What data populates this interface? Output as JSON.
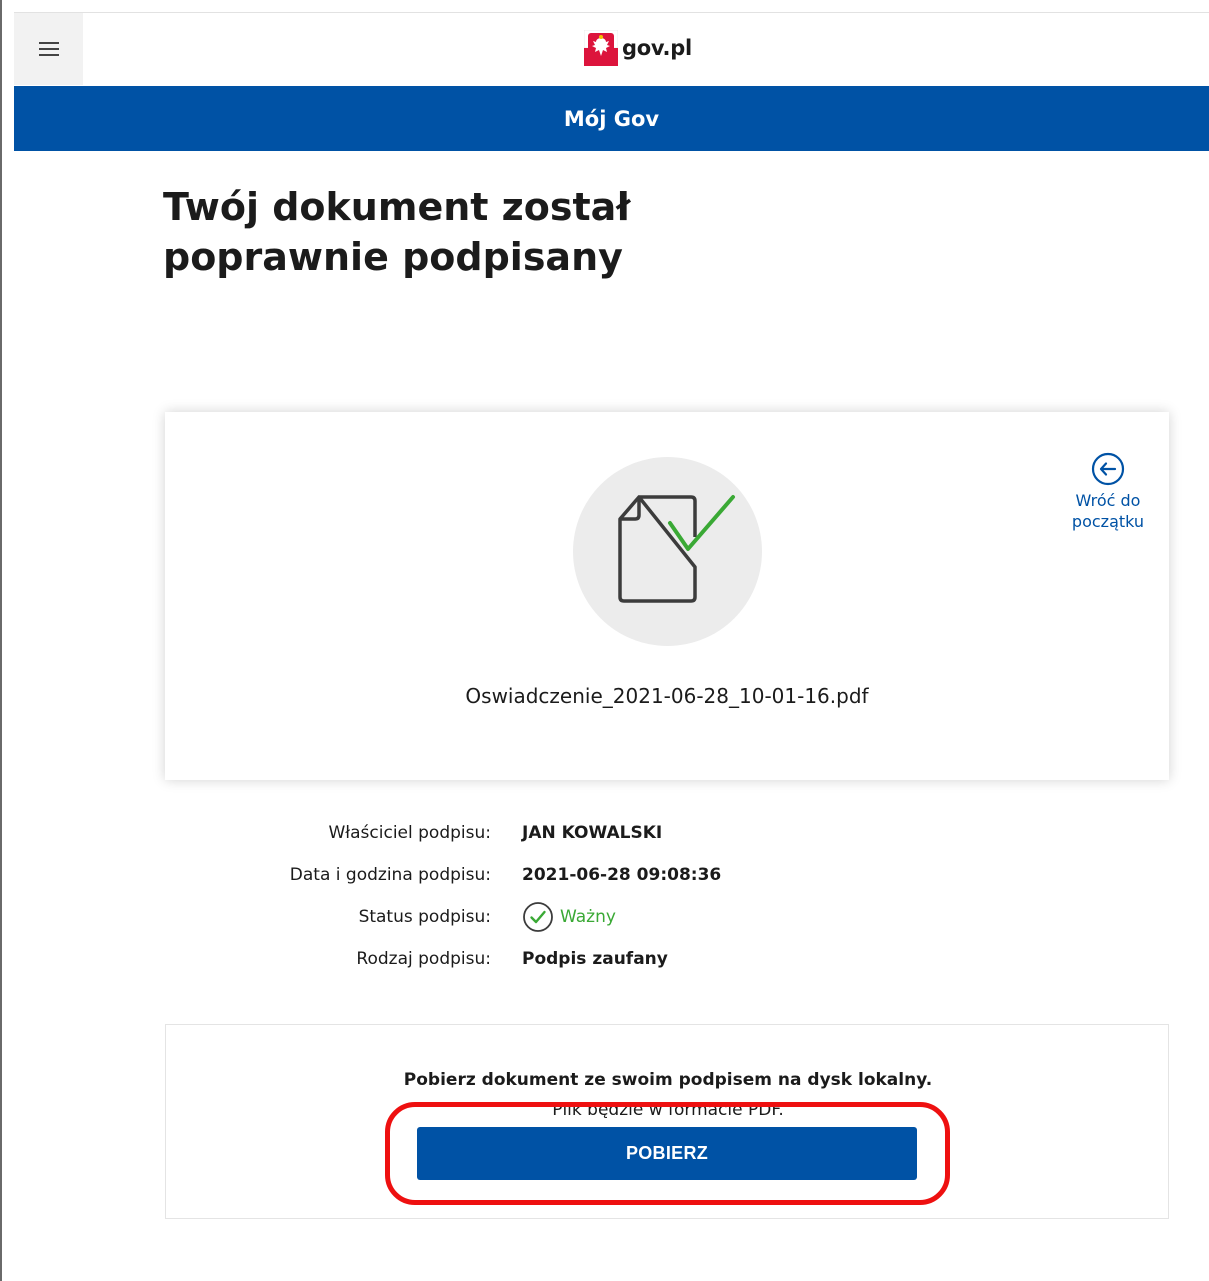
{
  "header": {
    "menu_icon": "hamburger-menu-icon",
    "logo_text": "gov.pl",
    "logo_icon": "polish-eagle-flag-icon",
    "bar_title": "Mój Gov"
  },
  "page": {
    "title_line1": "Twój dokument został",
    "title_line2": "poprawnie podpisany"
  },
  "document": {
    "icon": "document-check-icon",
    "back_link_line1": "Wróć do",
    "back_link_line2": "początku",
    "back_icon": "arrow-left-circle-icon",
    "file_name": "Oswiadczenie_2021-06-28_10-01-16.pdf"
  },
  "signature": {
    "owner_label": "Właściciel podpisu:",
    "owner_value": "JAN KOWALSKI",
    "date_label": "Data i godzina podpisu:",
    "date_value": "2021-06-28 09:08:36",
    "status_label": "Status podpisu:",
    "status_value": "Ważny",
    "status_icon": "check-circle-icon",
    "type_label": "Rodzaj podpisu:",
    "type_value": "Podpis zaufany"
  },
  "download": {
    "title": "Pobierz dokument ze swoim podpisem na dysk lokalny.",
    "subtitle": "Plik będzie w formacie PDF.",
    "button_label": "POBIERZ"
  },
  "colors": {
    "brand_blue": "#0052a5",
    "valid_green": "#3aa935",
    "highlight_red": "#ee1010"
  }
}
